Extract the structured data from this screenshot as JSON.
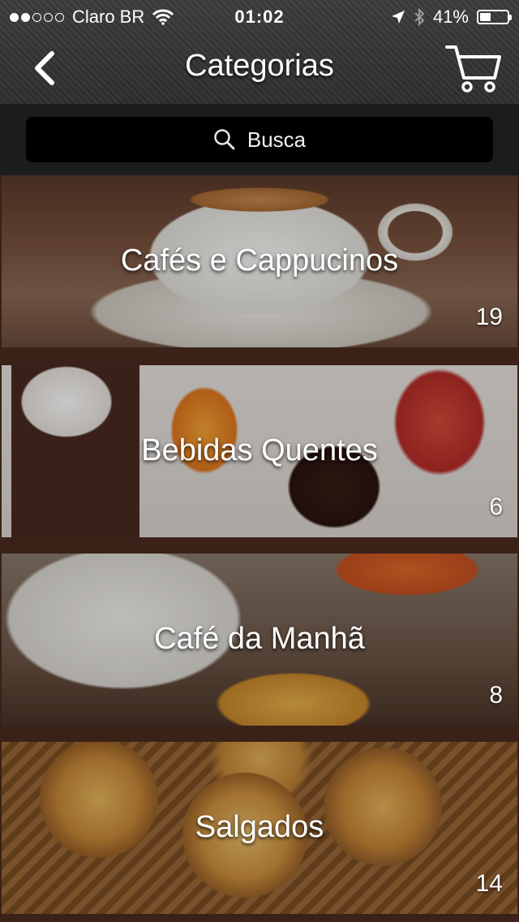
{
  "status_bar": {
    "carrier": "Claro BR",
    "time": "01:02",
    "battery": "41%",
    "battery_level": 0.41,
    "signal_dots_filled": 2,
    "signal_dots_total": 5
  },
  "nav": {
    "title": "Categorias",
    "back_icon": "chevron-left-icon",
    "cart_icon": "shopping-cart-icon"
  },
  "search": {
    "placeholder": "Busca",
    "icon": "search-icon"
  },
  "categories": [
    {
      "name": "Cafés e Cappucinos",
      "count": "19"
    },
    {
      "name": "Bebidas Quentes",
      "count": "6"
    },
    {
      "name": "Café da Manhã",
      "count": "8"
    },
    {
      "name": "Salgados",
      "count": "14"
    }
  ],
  "colors": {
    "separator": "#3a2218",
    "search_bg": "#000000",
    "text": "#ffffff"
  }
}
